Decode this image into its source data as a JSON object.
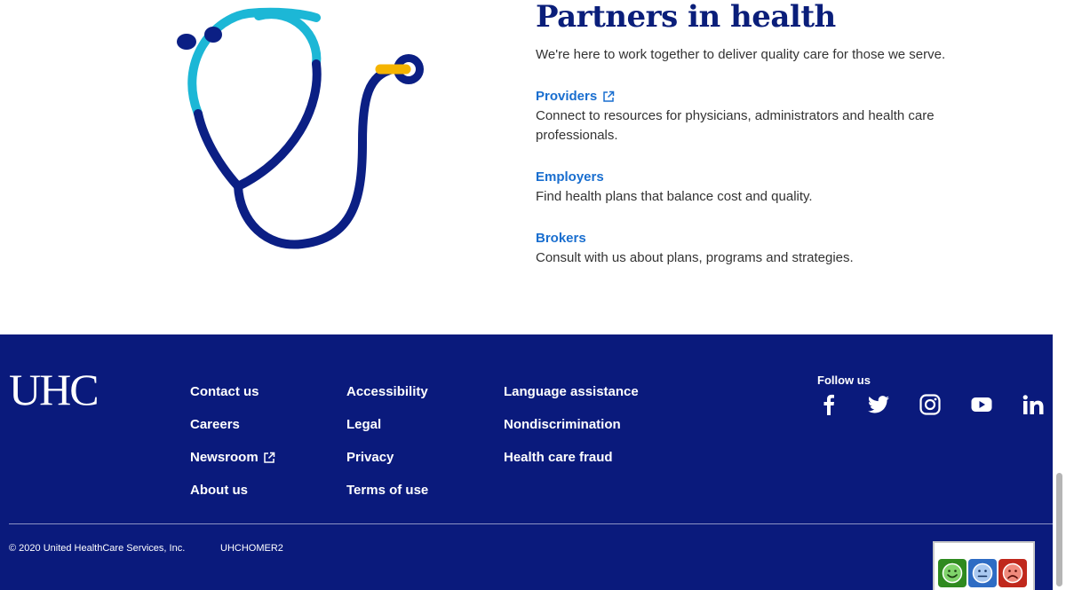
{
  "partners": {
    "title": "Partners in health",
    "intro": "We're here to work together to deliver quality care for those we serve.",
    "audiences": [
      {
        "label": "Providers",
        "external": true,
        "description": "Connect to resources for physicians, administrators and health care professionals."
      },
      {
        "label": "Employers",
        "external": false,
        "description": "Find health plans that balance cost and quality."
      },
      {
        "label": "Brokers",
        "external": false,
        "description": "Consult with us about plans, programs and strategies."
      }
    ]
  },
  "footer": {
    "logo": "UHC",
    "columns": [
      [
        {
          "label": "Contact us"
        },
        {
          "label": "Careers"
        },
        {
          "label": "Newsroom",
          "external": true
        },
        {
          "label": "About us"
        }
      ],
      [
        {
          "label": "Accessibility"
        },
        {
          "label": "Legal"
        },
        {
          "label": "Privacy"
        },
        {
          "label": "Terms of use"
        }
      ],
      [
        {
          "label": "Language assistance"
        },
        {
          "label": "Nondiscrimination"
        },
        {
          "label": "Health care fraud"
        }
      ]
    ],
    "follow_label": "Follow us",
    "social": [
      "facebook-icon",
      "twitter-icon",
      "instagram-icon",
      "youtube-icon",
      "linkedin-icon"
    ],
    "copyright": "© 2020 United HealthCare Services, Inc.",
    "page_code": "UHCHOMER2"
  },
  "feedback": {
    "options": [
      "happy-face-icon",
      "neutral-face-icon",
      "sad-face-icon"
    ]
  },
  "colors": {
    "navy": "#0a1a7c",
    "link_blue": "#196ecf",
    "title_navy": "#0a1e7a",
    "stethoscope_cyan": "#1cb7d6",
    "stethoscope_navy": "#0b1f84",
    "stethoscope_gold": "#f5b400"
  }
}
